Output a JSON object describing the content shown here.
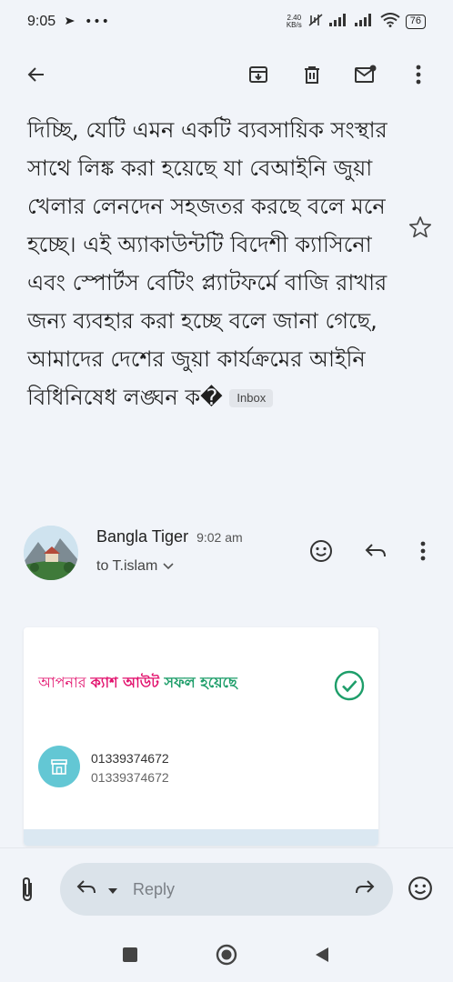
{
  "status_bar": {
    "time": "9:05",
    "net_speed_value": "2.40",
    "net_speed_unit": "KB/s",
    "battery": "76"
  },
  "email": {
    "body_text": "দিচ্ছি, যেটি এমন একটি ব্যবসায়িক সংস্থার সাথে লিঙ্ক করা হয়েছে যা বেআইনি জুয়া খেলার লেনদেন সহজতর করছে বলে মনে হচ্ছে। এই অ্যাকাউন্টটি বিদেশী ক্যাসিনো এবং স্পোর্টস বেটিং প্ল্যাটফর্মে বাজি রাখার জন্য ব্যবহার করা হচ্ছে বলে জানা গেছে, আমাদের দেশের জুয়া কার্যক্রমের আইনি বিধিনিষেধ লঙ্ঘন ক�",
    "label_chip": "Inbox",
    "sender_name": "Bangla Tiger",
    "sent_time": "9:02 am",
    "to_line": "to T.islam"
  },
  "card": {
    "title_part1": "আপনার ",
    "title_part2": "ক্যাশ আউট",
    "title_part3": " সফল হয়েছে",
    "number_primary": "01339374672",
    "number_secondary": "01339374672",
    "colors": {
      "brand_pink": "#e2136e",
      "success_green": "#1e9e6a"
    }
  },
  "reply_bar": {
    "reply_label": "Reply"
  },
  "icons": [
    "back-arrow-icon",
    "archive-icon",
    "delete-icon",
    "mark-unread-icon",
    "more-vert-icon",
    "star-icon",
    "emoji-icon",
    "reply-icon",
    "forward-icon",
    "attach-icon"
  ]
}
